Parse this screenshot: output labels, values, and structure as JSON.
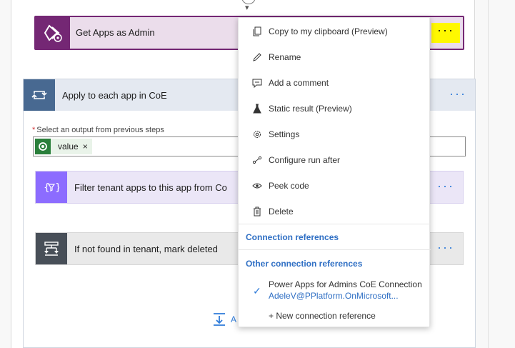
{
  "flow": {
    "get_apps": {
      "title": "Get Apps as Admin",
      "more": "···"
    },
    "apply_each": {
      "title": "Apply to each app in CoE",
      "more": "···"
    },
    "field": {
      "required_mark": "*",
      "label": "Select an output from previous steps",
      "token": "value",
      "token_remove": "×"
    },
    "filter": {
      "title": "Filter tenant apps to this app from Co",
      "more": "···"
    },
    "condition": {
      "title": "If not found in tenant, mark deleted",
      "more": "···"
    },
    "add_action": {
      "label": "A"
    }
  },
  "menu": {
    "items": [
      {
        "label": "Copy to my clipboard (Preview)",
        "icon": "copy-icon"
      },
      {
        "label": "Rename",
        "icon": "pencil-icon"
      },
      {
        "label": "Add a comment",
        "icon": "comment-icon"
      },
      {
        "label": "Static result (Preview)",
        "icon": "flask-icon"
      },
      {
        "label": "Settings",
        "icon": "gear-icon"
      },
      {
        "label": "Configure run after",
        "icon": "run-after-icon"
      },
      {
        "label": "Peek code",
        "icon": "eye-icon"
      },
      {
        "label": "Delete",
        "icon": "trash-icon"
      }
    ],
    "connection_references": "Connection references",
    "other_connection_references": "Other connection references",
    "connection": {
      "name": "Power Apps for Admins CoE Connection",
      "account": "AdeleV@PPlatform.OnMicrosoft..."
    },
    "new_connection": "+ New connection reference"
  },
  "colors": {
    "highlight": "#fff800",
    "powerapps_purple": "#742774",
    "link_blue": "#2f7bd9",
    "loop_blue": "#486991",
    "filter_purple": "#8c6cff"
  }
}
